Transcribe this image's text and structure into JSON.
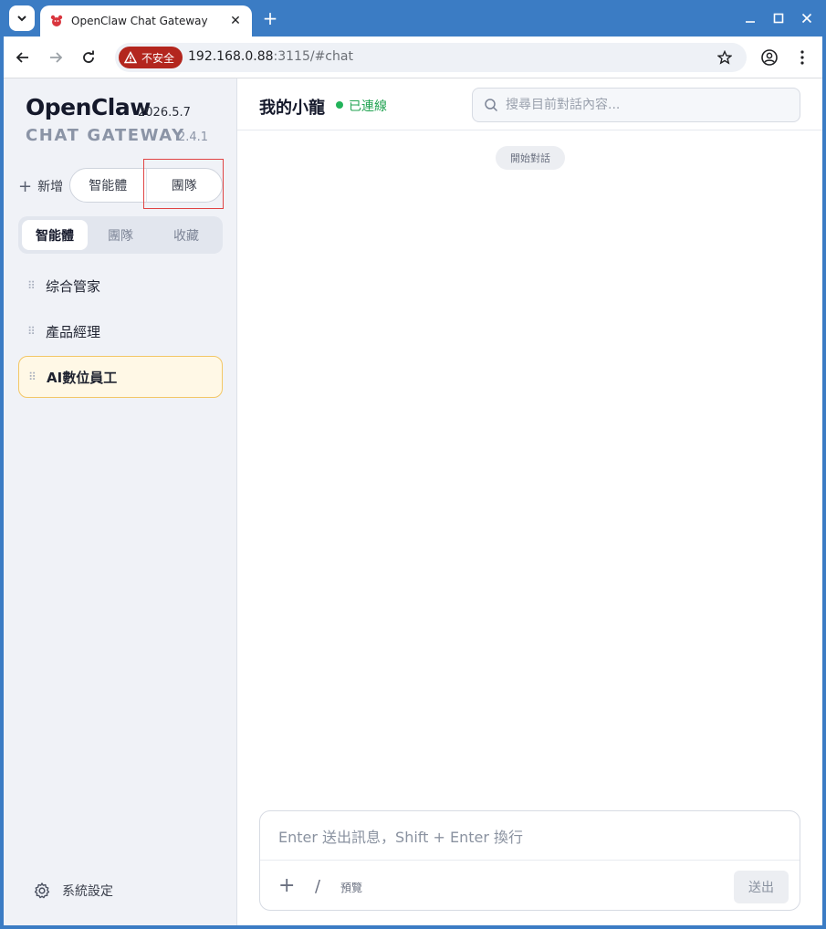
{
  "browser": {
    "tab_title": "OpenClaw Chat Gateway",
    "security_label": "不安全",
    "url_host": "192.168.0.88",
    "url_rest": ":3115/#chat"
  },
  "sidebar": {
    "brand_name": "OpenClaw",
    "brand_version": "2026.5.7",
    "brand_sub": "CHAT GATEWAY",
    "brand_sub_version": "2.4.1",
    "add_label": "新增",
    "new_buttons": [
      "智能體",
      "團隊"
    ],
    "tabs": [
      "智能體",
      "團隊",
      "收藏"
    ],
    "agents": [
      "综合管家",
      "產品經理",
      "AI數位員工"
    ],
    "settings_label": "系統設定"
  },
  "chat": {
    "title": "我的小龍",
    "status": "已連線",
    "search_placeholder": "搜尋目前對話內容...",
    "start_label": "開始對話",
    "input_placeholder": "Enter 送出訊息，Shift + Enter 換行",
    "slash": "/",
    "preview_label": "預覽",
    "send_label": "送出"
  },
  "colors": {
    "titlebar": "#3b7cc4",
    "status_green": "#22b35a",
    "selected_bg": "#fff8e6",
    "highlight_box": "#e04444"
  }
}
